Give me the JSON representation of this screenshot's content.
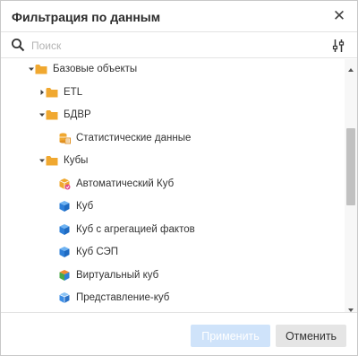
{
  "dialog": {
    "title": "Фильтрация по данным",
    "close_icon": "close-icon"
  },
  "search": {
    "placeholder": "Поиск",
    "value": "",
    "search_icon": "search-icon",
    "filter_icon": "filter-settings-icon"
  },
  "tree": {
    "items": [
      {
        "label": "Базовые объекты",
        "level": 0,
        "expander": "expanded",
        "icon": "folder-icon"
      },
      {
        "label": "ETL",
        "level": 1,
        "expander": "collapsed",
        "icon": "folder-icon"
      },
      {
        "label": "БДВР",
        "level": 1,
        "expander": "expanded",
        "icon": "folder-icon"
      },
      {
        "label": "Статистические данные",
        "level": 2,
        "expander": "none",
        "icon": "database-icon"
      },
      {
        "label": "Кубы",
        "level": 1,
        "expander": "expanded",
        "icon": "folder-icon"
      },
      {
        "label": "Автоматический Куб",
        "level": 2,
        "expander": "none",
        "icon": "automatic-cube-icon"
      },
      {
        "label": "Куб",
        "level": 2,
        "expander": "none",
        "icon": "cube-icon"
      },
      {
        "label": "Куб с агрегацией фактов",
        "level": 2,
        "expander": "none",
        "icon": "cube-icon"
      },
      {
        "label": "Куб СЭП",
        "level": 2,
        "expander": "none",
        "icon": "cube-icon"
      },
      {
        "label": "Виртуальный куб",
        "level": 2,
        "expander": "none",
        "icon": "virtual-cube-icon"
      },
      {
        "label": "Представление-куб",
        "level": 2,
        "expander": "none",
        "icon": "cube-view-icon"
      }
    ]
  },
  "footer": {
    "apply_label": "Применить",
    "apply_enabled": false,
    "cancel_label": "Отменить"
  },
  "colors": {
    "folder": "#f0a830",
    "cube": "#3c8ee6",
    "apply_disabled_bg": "#cfe3fa",
    "cancel_bg": "#e5e5e5"
  }
}
